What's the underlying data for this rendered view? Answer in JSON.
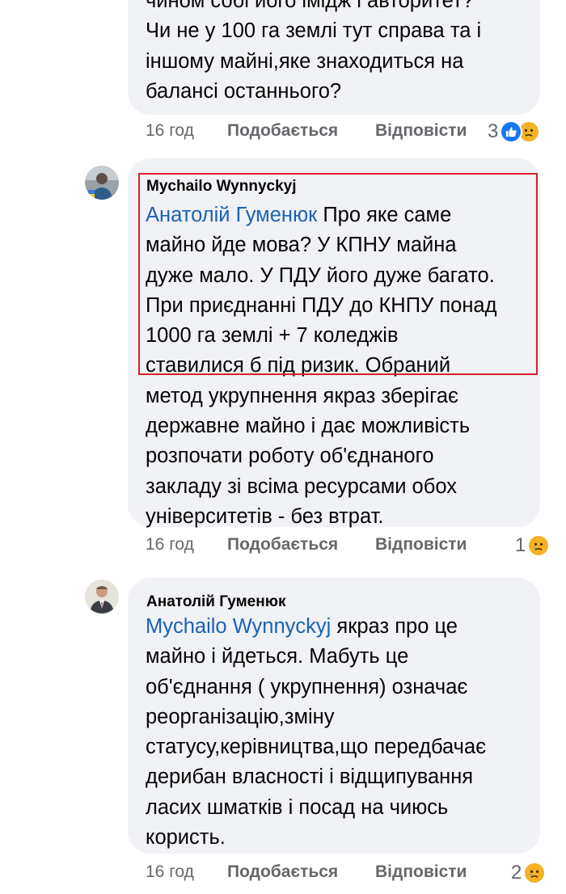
{
  "comments": [
    {
      "lines": [
        "чином собі його імідж і авторитет?",
        "Чи не у 100 га землі тут справа та і",
        "іншому майні,яке знаходиться на",
        "балансі останнього?"
      ],
      "time": "16 год",
      "like_label": "Подобається",
      "reply_label": "Відповісти",
      "reaction_count": "3",
      "reactions": [
        "like-icon",
        "sad-icon"
      ]
    },
    {
      "author": "Mychailo Wynnyckyj",
      "mention": "Анатолій Гуменюк",
      "lines_first_rest": " Про яке саме",
      "lines": [
        "майно йде мова? У КПНУ майна",
        "дуже мало. У ПДУ його дуже багато.",
        "При приєднанні ПДУ до КНПУ понад",
        "1000 га землі + 7 коледжів",
        "ставилися б під ризик. Обраний",
        "метод укрупнення якраз зберігає",
        "державне майно і дає можливість",
        "розпочати роботу об'єднаного",
        "закладу зі всіма ресурсами обох",
        "університетів - без втрат."
      ],
      "time": "16 год",
      "like_label": "Подобається",
      "reply_label": "Відповісти",
      "reaction_count": "1",
      "reactions": [
        "sad-icon"
      ]
    },
    {
      "author": "Анатолій Гуменюк",
      "mention": "Mychailo Wynnyckyj",
      "lines_first_rest": " якраз про це",
      "lines": [
        "майно і йдеться. Мабуть це",
        "об'єднання ( укрупнення) означає",
        "реорганізацію,зміну",
        "статусу,керівництва,що передбачає",
        "дерибан власності і відщипування",
        "ласих шматків і посад на чиюсь",
        "користь."
      ],
      "time": "16 год",
      "like_label": "Подобається",
      "reply_label": "Відповісти",
      "reaction_count": "2",
      "reactions": [
        "sad-icon"
      ]
    }
  ],
  "colors": {
    "bubble": "#f0f2f5",
    "mention": "#1b62b4",
    "meta": "#65676b",
    "highlight_border": "#d6202c",
    "like_reaction": "#1877f2",
    "sad_reaction": "#f7b125"
  }
}
